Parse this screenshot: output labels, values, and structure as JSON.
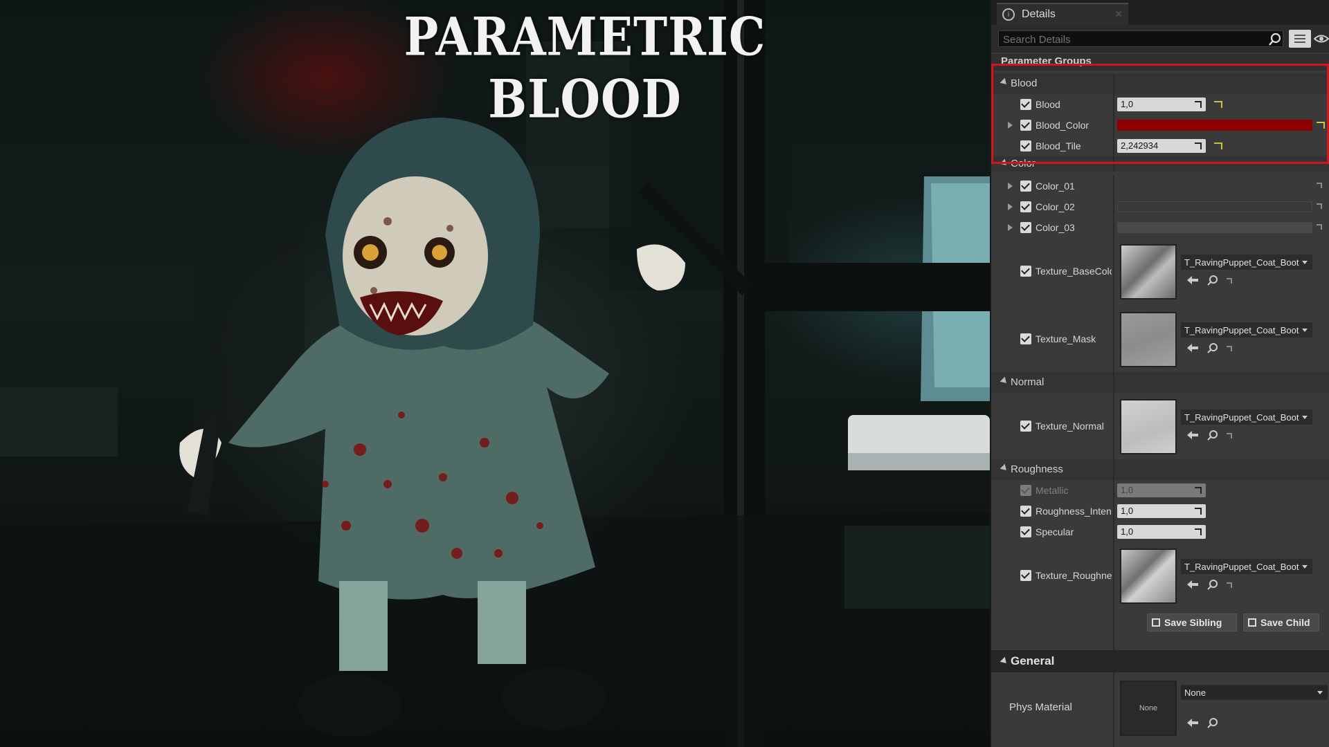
{
  "overlay_title": "PARAMETRIC BLOOD",
  "details": {
    "tab_label": "Details",
    "search_placeholder": "Search Details",
    "groups_header": "Parameter Groups",
    "sections": {
      "blood": {
        "label": "Blood",
        "params": {
          "blood": {
            "label": "Blood",
            "value": "1,0"
          },
          "blood_color": {
            "label": "Blood_Color",
            "color": "#8c0000"
          },
          "blood_tile": {
            "label": "Blood_Tile",
            "value": "2,242934"
          }
        }
      },
      "color": {
        "label": "Color",
        "params": {
          "color_01": {
            "label": "Color_01"
          },
          "color_02": {
            "label": "Color_02"
          },
          "color_03": {
            "label": "Color_03"
          },
          "texture_basecolor": {
            "label": "Texture_BaseColc",
            "asset": "T_RavingPuppet_Coat_Boot"
          },
          "texture_mask": {
            "label": "Texture_Mask",
            "asset": "T_RavingPuppet_Coat_Boot"
          }
        }
      },
      "normal": {
        "label": "Normal",
        "params": {
          "texture_normal": {
            "label": "Texture_Normal",
            "asset": "T_RavingPuppet_Coat_Boot"
          }
        }
      },
      "roughness": {
        "label": "Roughness",
        "params": {
          "metallic": {
            "label": "Metallic",
            "value": "1,0"
          },
          "roughness_intensity": {
            "label": "Roughness_Intens",
            "value": "1,0"
          },
          "specular": {
            "label": "Specular",
            "value": "1,0"
          },
          "texture_roughness": {
            "label": "Texture_Roughnes",
            "asset": "T_RavingPuppet_Coat_Boot"
          }
        }
      }
    },
    "buttons": {
      "save_sibling": "Save Sibling",
      "save_child": "Save Child"
    },
    "general": {
      "label": "General",
      "phys_material": {
        "label": "Phys Material",
        "thumb": "None",
        "value": "None"
      }
    }
  },
  "colors": {
    "highlight_frame": "#d4141c",
    "blood_color": "#8c0000",
    "reset_arrow": "#d6c23a"
  }
}
